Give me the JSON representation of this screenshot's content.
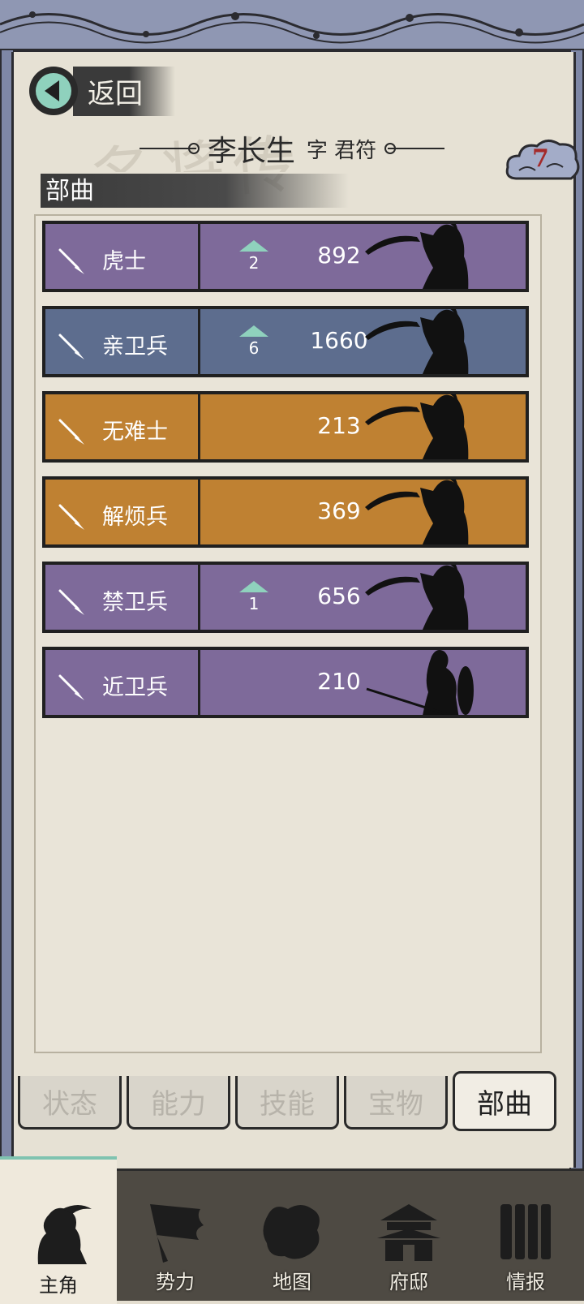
{
  "header": {
    "back_label": "返回",
    "hero_name": "李长生",
    "courtesy": "字 君符",
    "badge_count": "7",
    "watermark": "名将传"
  },
  "section": {
    "title": "部曲"
  },
  "units": [
    {
      "name": "虎士",
      "rank": "2",
      "count": "892",
      "color": "#7e6a9a",
      "has_rank": true,
      "figure": "blade"
    },
    {
      "name": "亲卫兵",
      "rank": "6",
      "count": "1660",
      "color": "#5d6d8e",
      "has_rank": true,
      "figure": "blade"
    },
    {
      "name": "无难士",
      "rank": "",
      "count": "213",
      "color": "#bf8132",
      "has_rank": false,
      "figure": "blade"
    },
    {
      "name": "解烦兵",
      "rank": "",
      "count": "369",
      "color": "#bf8132",
      "has_rank": false,
      "figure": "blade"
    },
    {
      "name": "禁卫兵",
      "rank": "1",
      "count": "656",
      "color": "#7e6a9a",
      "has_rank": true,
      "figure": "blade"
    },
    {
      "name": "近卫兵",
      "rank": "",
      "count": "210",
      "color": "#7e6a9a",
      "has_rank": false,
      "figure": "shield"
    }
  ],
  "tabs": [
    {
      "label": "状态",
      "active": false
    },
    {
      "label": "能力",
      "active": false
    },
    {
      "label": "技能",
      "active": false
    },
    {
      "label": "宝物",
      "active": false
    },
    {
      "label": "部曲",
      "active": true
    }
  ],
  "nav": [
    {
      "label": "主角",
      "icon": "hero-icon",
      "active": true
    },
    {
      "label": "势力",
      "icon": "flag-icon",
      "active": false
    },
    {
      "label": "地图",
      "icon": "map-icon",
      "active": false
    },
    {
      "label": "府邸",
      "icon": "mansion-icon",
      "active": false
    },
    {
      "label": "情报",
      "icon": "scroll-icon",
      "active": false
    }
  ],
  "colors": {
    "purple": "#7e6a9a",
    "blue": "#5d6d8e",
    "orange": "#bf8132",
    "teal": "#8fd1bd"
  }
}
